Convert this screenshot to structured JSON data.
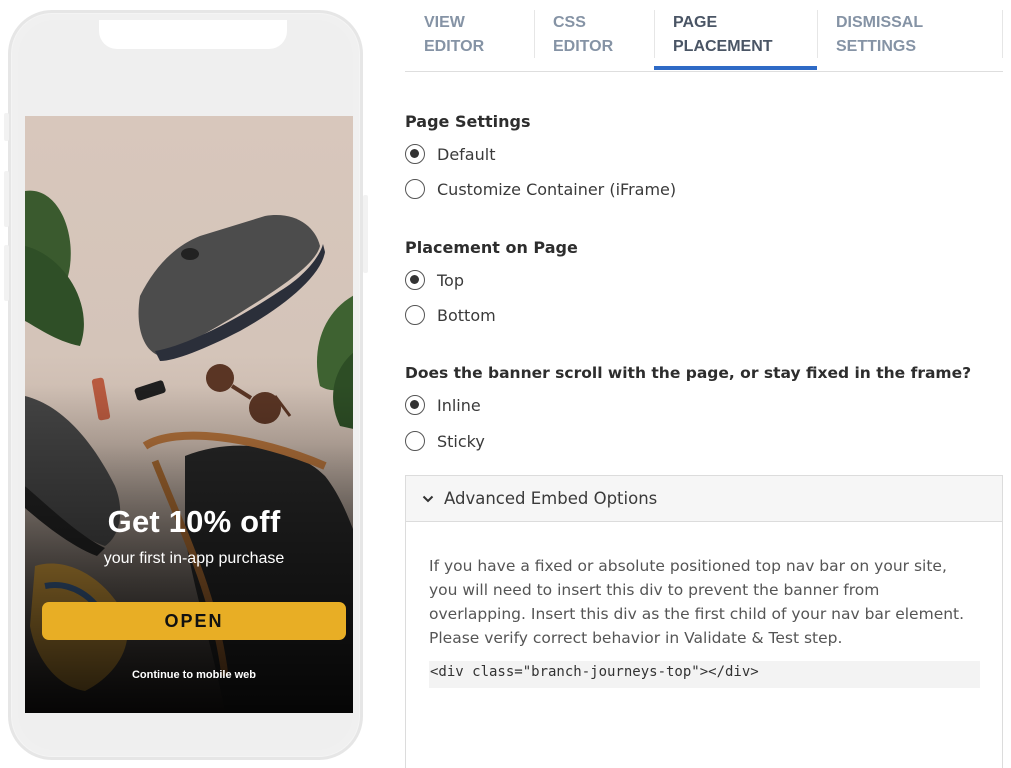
{
  "preview": {
    "promo_title": "Get 10% off",
    "promo_subtitle": "your first in-app purchase",
    "open_button": "OPEN",
    "continue_link": "Continue to mobile web",
    "accent_color": "#e8ae25"
  },
  "tabs": [
    {
      "line1": "VIEW",
      "line2": "EDITOR"
    },
    {
      "line1": "CSS",
      "line2": "EDITOR"
    },
    {
      "line1": "PAGE",
      "line2": "PLACEMENT"
    },
    {
      "line1": "DISMISSAL",
      "line2": "SETTINGS"
    }
  ],
  "active_tab": "PAGE PLACEMENT",
  "page_settings": {
    "label": "Page Settings",
    "options": [
      "Default",
      "Customize Container (iFrame)"
    ],
    "selected": "Default"
  },
  "placement": {
    "label": "Placement on Page",
    "options": [
      "Top",
      "Bottom"
    ],
    "selected": "Top"
  },
  "scroll": {
    "label": "Does the banner scroll with the page, or stay fixed in the frame?",
    "options": [
      "Inline",
      "Sticky"
    ],
    "selected": "Inline"
  },
  "advanced": {
    "title": "Advanced Embed Options",
    "description": "If you have a fixed or absolute positioned top nav bar on your site, you will need to insert this div to prevent the banner from overlapping. Insert this div as the first child of your nav bar element. Please verify correct behavior in Validate & Test step.",
    "code": "<div class=\"branch-journeys-top\"></div>"
  },
  "colors": {
    "active_tab_underline": "#2e6ac6",
    "inactive_tab_text": "#8593a5"
  }
}
